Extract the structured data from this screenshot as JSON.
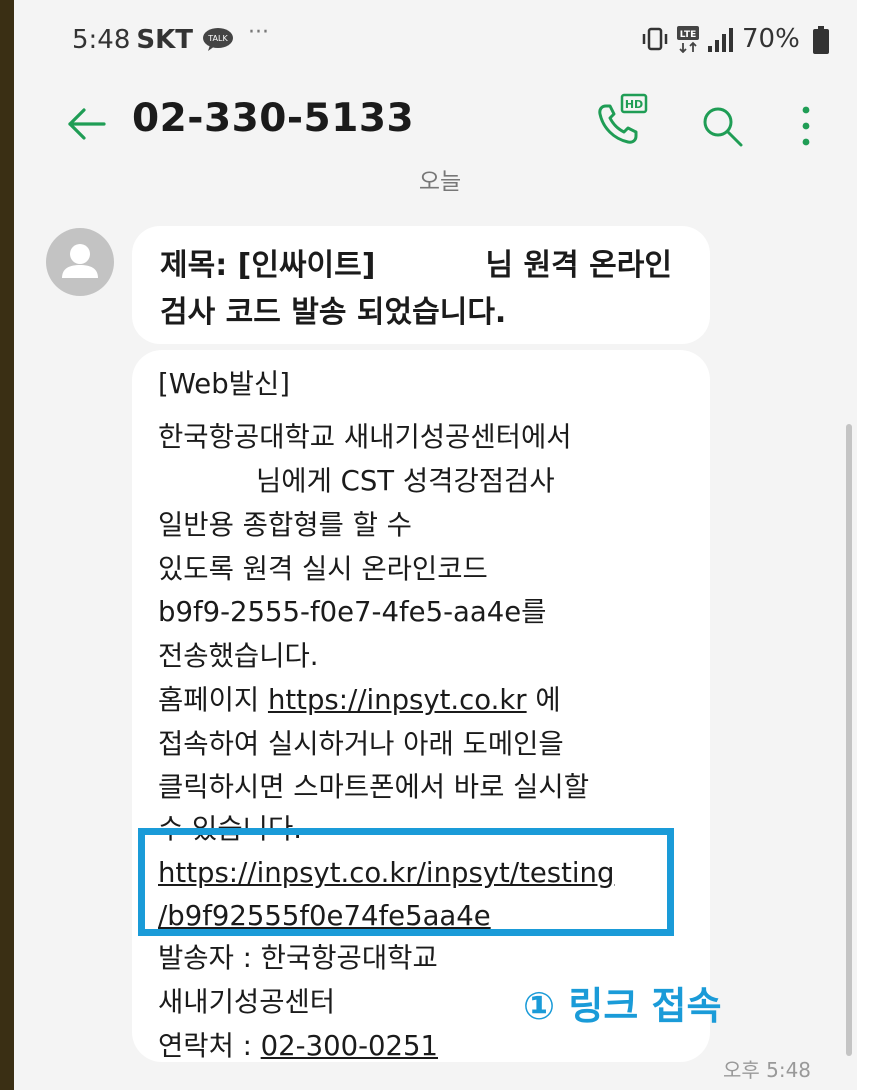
{
  "status_bar": {
    "time": "5:48",
    "carrier": "SKT",
    "talk_badge": "TALK",
    "dots": "···",
    "lte": "LTE",
    "battery": "70%"
  },
  "header": {
    "title": "02-330-5133",
    "hd_badge": "HD"
  },
  "date_separator": "오늘",
  "subject_bubble": {
    "line1_prefix": "제목: [인싸이트]",
    "line1_suffix": "님 원격 온라인",
    "line2": "검사 코드 발송 되었습니다."
  },
  "body_bubble": {
    "line1": "[Web발신]",
    "line2": "한국항공대학교 새내기성공센터에서",
    "line3_suffix": "님에게 CST 성격강점검사",
    "line4": "일반용   종합형를 할 수",
    "line5": "있도록 원격 실시  온라인코드",
    "line6": "b9f9-2555-f0e7-4fe5-aa4e를",
    "line7": "전송했습니다.",
    "line8_prefix": "홈페이지",
    "homepage_link": "https://inpsyt.co.kr",
    "line8_suffix": "에",
    "line9": "접속하여 실시하거나 아래 도메인을",
    "line10": "클릭하시면 스마트폰에서 바로 실시할",
    "line11": "수 있습니다.",
    "testing_link_line1": "https://inpsyt.co.kr/inpsyt/testing",
    "testing_link_line2": "/b9f92555f0e74fe5aa4e",
    "sender_line1": "발송자 : 한국항공대학교",
    "sender_line2": "새내기성공센터",
    "contact_prefix": "연락처 :",
    "contact_phone": "02-300-0251"
  },
  "message_time": "오후 5:48",
  "annotation": "① 링크 접속",
  "colors": {
    "accent_green": "#1f9d55",
    "annotation_blue": "#1a9bd8",
    "background": "#f4f4f4",
    "bubble": "#ffffff"
  }
}
